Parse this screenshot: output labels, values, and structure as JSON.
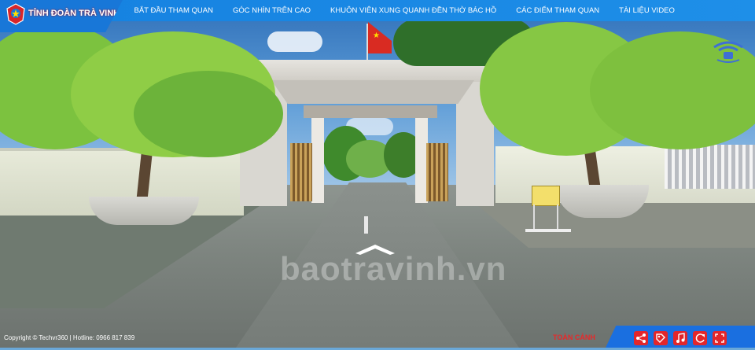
{
  "brand": {
    "name": "TỈNH ĐOÀN TRÀ VINH",
    "logo_icon": "youth-union-emblem-icon"
  },
  "menu": {
    "items": [
      {
        "label": "BẮT ĐẦU THAM QUAN"
      },
      {
        "label": "GÓC NHÌN TRÊN CAO"
      },
      {
        "label": "KHUÔN VIÊN XUNG QUANH ĐỀN THỜ BÁC HỒ"
      },
      {
        "label": "CÁC ĐIỂM THAM QUAN"
      },
      {
        "label": "TÀI LIỆU VIDEO"
      }
    ]
  },
  "scene": {
    "watermark": "baotravinh.vn",
    "nav_arrow_icon": "forward-arrow-icon",
    "gyro_icon": "gyroscope-icon"
  },
  "footer": {
    "copyright": "Copyright © Techvr360 | Hotline: 0966 817 839",
    "view_label": "TOÀN CẢNH",
    "controls": [
      {
        "icon": "share-icon"
      },
      {
        "icon": "tag-icon"
      },
      {
        "icon": "music-icon"
      },
      {
        "icon": "auto-rotate-icon"
      },
      {
        "icon": "fullscreen-icon"
      }
    ]
  },
  "colors": {
    "topbar": "#1581e0",
    "accent_red": "#e3262b",
    "control_bar": "#1a6fe0"
  }
}
